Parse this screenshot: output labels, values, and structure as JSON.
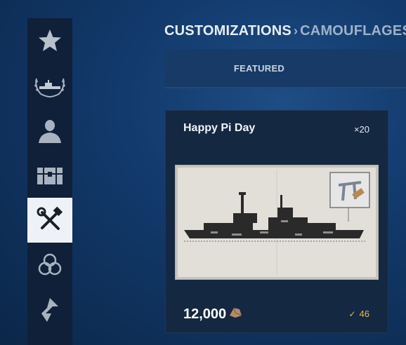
{
  "sidebar": {
    "items": [
      {
        "name": "favorites",
        "icon": "star-icon",
        "active": false
      },
      {
        "name": "ship",
        "icon": "ship-laurel-icon",
        "active": false
      },
      {
        "name": "profile",
        "icon": "person-icon",
        "active": false
      },
      {
        "name": "containers",
        "icon": "chest-icon",
        "active": false
      },
      {
        "name": "customizations",
        "icon": "wrench-hammer-icon",
        "active": true
      },
      {
        "name": "clan",
        "icon": "clan-emblem-icon",
        "active": false
      },
      {
        "name": "directives",
        "icon": "arrow-emblem-icon",
        "active": false
      }
    ]
  },
  "breadcrumb": {
    "root": "CUSTOMIZATIONS",
    "separator": "›",
    "current": "CAMOUFLAGES"
  },
  "tabs": [
    {
      "label": "FEATURED",
      "active": true
    }
  ],
  "card": {
    "title": "Happy Pi Day",
    "quantity": "×20",
    "price": "12,000",
    "price_currency_icon": "steel-icon",
    "preview_badge_icon": "pi-hammer-icon",
    "stat_icon": "check-icon",
    "stat_value": "46"
  },
  "colors": {
    "accent_gold": "#e5b94b",
    "sidebar_bg": "#0f2038",
    "card_bg": "#142842"
  }
}
